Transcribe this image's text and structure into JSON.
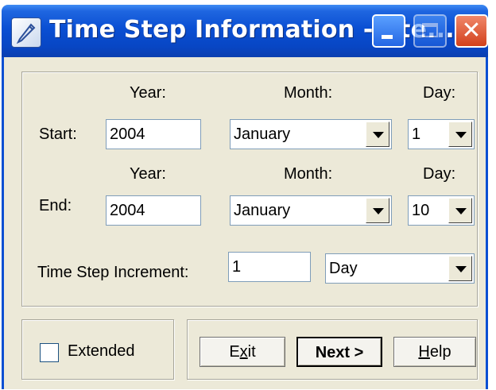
{
  "window": {
    "title": "Time Step Information - Ste..."
  },
  "start": {
    "label": "Start:",
    "year_header": "Year:",
    "month_header": "Month:",
    "day_header": "Day:",
    "year": "2004",
    "month": "January",
    "day": "1"
  },
  "end": {
    "label": "End:",
    "year_header": "Year:",
    "month_header": "Month:",
    "day_header": "Day:",
    "year": "2004",
    "month": "January",
    "day": "10"
  },
  "increment": {
    "label": "Time Step Increment:",
    "value": "1",
    "unit": "Day"
  },
  "extended": {
    "label": "Extended",
    "checked": false
  },
  "buttons": {
    "exit_pre": "E",
    "exit_u": "x",
    "exit_post": "it",
    "next": "Next >",
    "help_u": "H",
    "help_post": "elp"
  },
  "colors": {
    "titlebar": "#0a4fd3",
    "dialog_bg": "#ece9d8",
    "close_button": "#d2411c"
  }
}
